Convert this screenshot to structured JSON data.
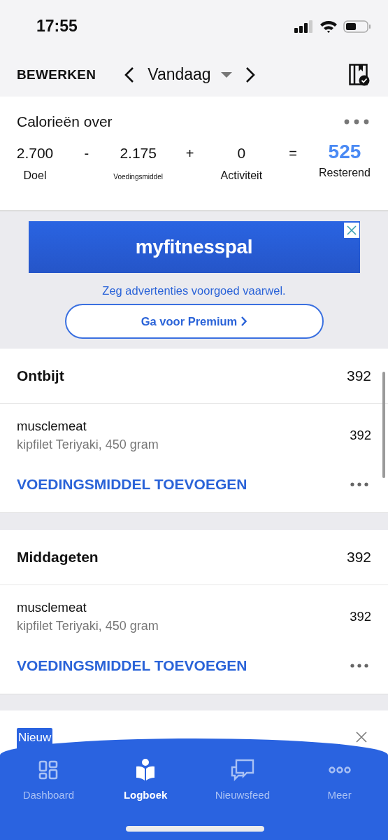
{
  "status_bar": {
    "time": "17:55"
  },
  "nav_bar": {
    "edit_label": "BEWERKEN",
    "date_label": "Vandaag"
  },
  "calories": {
    "title": "Calorieën over",
    "terms": [
      {
        "kind": "value",
        "value": "2.700",
        "label": "Doel"
      },
      {
        "kind": "operator",
        "value": "-"
      },
      {
        "kind": "value",
        "value": "2.175",
        "label": "Voedingsmiddel",
        "small": true
      },
      {
        "kind": "operator",
        "value": "+"
      },
      {
        "kind": "value",
        "value": "0",
        "label": "Activiteit"
      },
      {
        "kind": "operator",
        "value": "="
      },
      {
        "kind": "result",
        "value": "525",
        "label": "Resterend"
      }
    ]
  },
  "ad": {
    "banner_text": "myfitnesspal",
    "message": "Zeg advertenties voorgoed vaarwel.",
    "button": "Ga voor Premium"
  },
  "meals": [
    {
      "title": "Ontbijt",
      "total": "392",
      "entries": [
        {
          "name": "musclemeat",
          "detail": "kipfilet Teriyaki, 450 gram",
          "calories": "392"
        }
      ],
      "add_label": "VOEDINGSMIDDEL TOEVOEGEN"
    },
    {
      "title": "Middageten",
      "total": "392",
      "entries": [
        {
          "name": "musclemeat",
          "detail": "kipfilet Teriyaki, 450 gram",
          "calories": "392"
        }
      ],
      "add_label": "VOEDINGSMIDDEL TOEVOEGEN"
    }
  ],
  "promo": {
    "badge": "Nieuw"
  },
  "tabs": [
    {
      "label": "Dashboard",
      "kind": "grid",
      "selected": false
    },
    {
      "label": "Logboek",
      "kind": "book",
      "selected": true
    },
    {
      "label": "Nieuwsfeed",
      "kind": "chat",
      "selected": false
    },
    {
      "label": "Meer",
      "kind": "more",
      "selected": false
    }
  ]
}
